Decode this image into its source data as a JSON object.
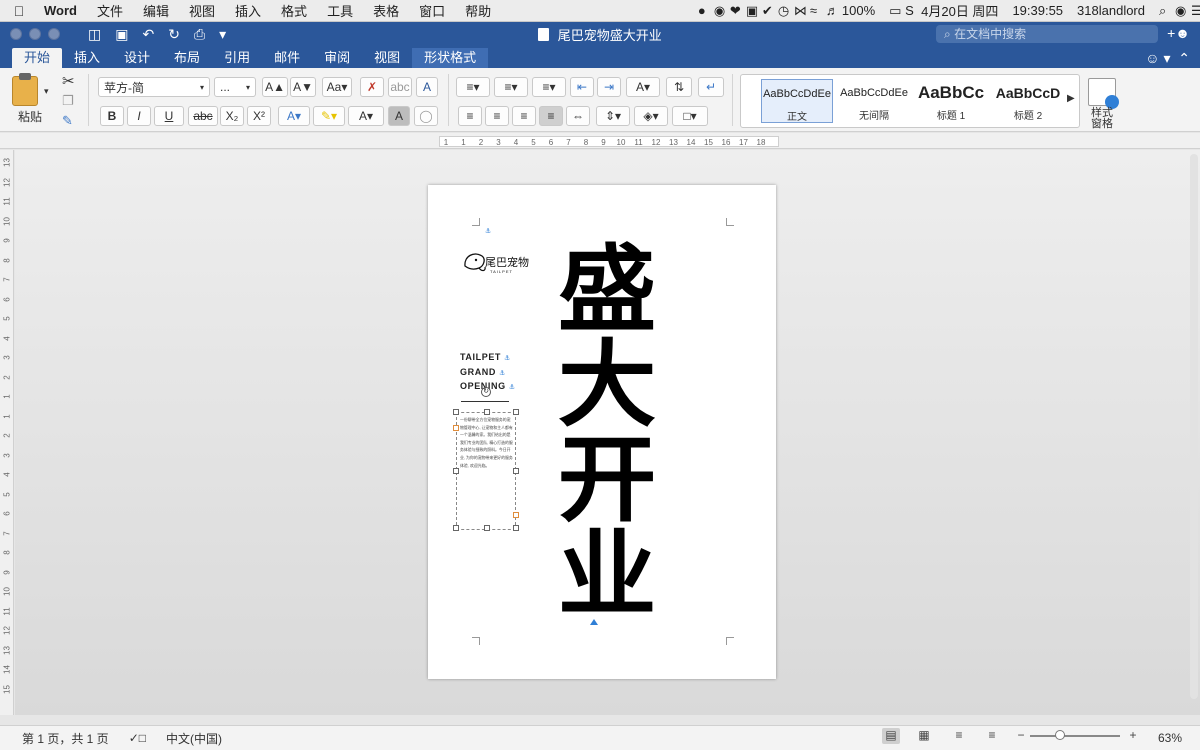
{
  "menubar": {
    "app": "Word",
    "items": [
      "文件",
      "编辑",
      "视图",
      "插入",
      "格式",
      "工具",
      "表格",
      "窗口",
      "帮助"
    ],
    "battery": "100%",
    "date": "4月20日 周四",
    "time": "19:39:55",
    "user": "318landlord"
  },
  "titlebar": {
    "doc_title": "尾巴宠物盛大开业",
    "search_placeholder": "在文档中搜索"
  },
  "tabs": [
    "开始",
    "插入",
    "设计",
    "布局",
    "引用",
    "邮件",
    "审阅",
    "视图",
    "形状格式"
  ],
  "active_tab": "开始",
  "ribbon": {
    "paste_label": "粘贴",
    "font_name": "苹方-简",
    "font_size": "...",
    "bold": "B",
    "italic": "I",
    "underline": "U",
    "strikethrough": "abc",
    "subscript": "X₂",
    "superscript": "X²",
    "styles": [
      {
        "sample": "AaBbCcDdEe",
        "name": "正文"
      },
      {
        "sample": "AaBbCcDdEe",
        "name": "无间隔"
      },
      {
        "sample": "AaBbCc",
        "name": "标题 1"
      },
      {
        "sample": "AaBbCcD",
        "name": "标题 2"
      }
    ],
    "styles_pane_label": "样式\n窗格"
  },
  "ruler": {
    "h_ticks": [
      "1",
      "1",
      "2",
      "3",
      "4",
      "5",
      "6",
      "7",
      "8",
      "9",
      "10",
      "11",
      "12",
      "13",
      "14",
      "15",
      "16",
      "17",
      "18"
    ],
    "v_ticks": [
      "13",
      "12",
      "11",
      "10",
      "9",
      "8",
      "7",
      "6",
      "5",
      "4",
      "3",
      "2",
      "1",
      "1",
      "2",
      "3",
      "4",
      "5",
      "6",
      "7",
      "8",
      "9",
      "10",
      "11",
      "12",
      "13",
      "14",
      "15"
    ]
  },
  "page": {
    "logo_text": "尾巴宠物",
    "logo_sub": "TAILPET",
    "headline_lines": [
      "TAILPET",
      "GRAND",
      "OPENING"
    ],
    "body_text": "一份聊带全方位宠物服务的宠物管理中心, 让宠物和主人都有一个温馨的家。我们给出的是我们专业的团队, 精心打造的服务体验与细致的照料。今日开业, 为你的宠物带来更好的服务体验, 欢迎光临。",
    "big_title_chars": [
      "盛",
      "大",
      "开",
      "业"
    ]
  },
  "statusbar": {
    "page_info": "第 1 页，共 1 页",
    "language": "中文(中国)",
    "zoom": "63%"
  }
}
